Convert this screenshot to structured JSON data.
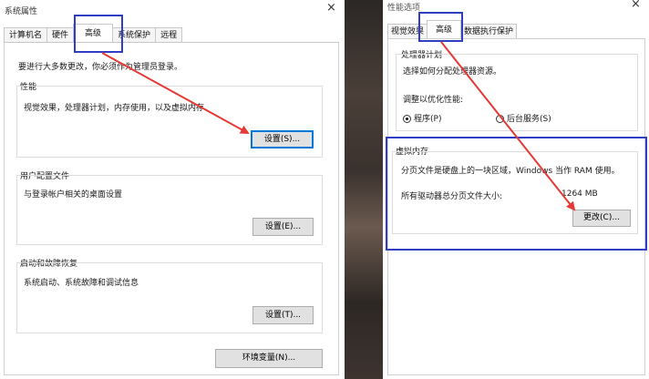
{
  "left": {
    "title": "系统属性",
    "close": "×",
    "tabs": [
      "计算机名",
      "硬件",
      "高级",
      "系统保护",
      "远程"
    ],
    "admin_note": "要进行大多数更改，你必须作为管理员登录。",
    "performance": {
      "heading": "性能",
      "desc": "视觉效果，处理器计划，内存使用，以及虚拟内存",
      "button": "设置(S)..."
    },
    "profile": {
      "heading": "用户配置文件",
      "desc": "与登录帐户相关的桌面设置",
      "button": "设置(E)..."
    },
    "startup": {
      "heading": "启动和故障恢复",
      "desc": "系统启动、系统故障和调试信息",
      "button": "设置(T)..."
    },
    "env_button": "环境变量(N)..."
  },
  "right": {
    "title": "性能选项",
    "close": "×",
    "tabs": [
      "视觉效果",
      "高级",
      "数据执行保护"
    ],
    "cpu": {
      "heading": "处理器计划",
      "desc": "选择如何分配处理器资源。",
      "adjust_label": "调整以优化性能:",
      "radio_programs": "程序(P)",
      "radio_services": "后台服务(S)"
    },
    "vm": {
      "heading": "虚拟内存",
      "desc": "分页文件是硬盘上的一块区域，Windows 当作 RAM 使用。",
      "total_label": "所有驱动器总分页文件大小:",
      "total_value": "1264 MB",
      "button": "更改(C)..."
    }
  },
  "colors": {
    "annotation_arrow": "#e53935",
    "annotation_box": "#2f3ec2",
    "focus_border": "#0078d7"
  }
}
